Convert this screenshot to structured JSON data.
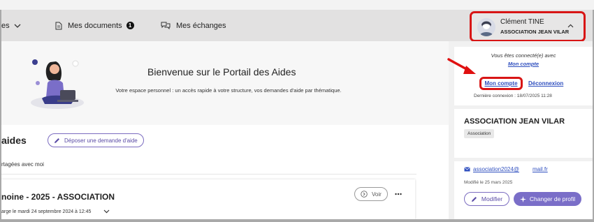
{
  "nav": {
    "aides_label": "es",
    "documents_label": "Mes documents",
    "documents_badge": "1",
    "echanges_label": "Mes échanges"
  },
  "user": {
    "name": "Clément TINE",
    "organization": "ASSOCIATION JEAN VILAR"
  },
  "welcome": {
    "title": "Bienvenue sur le Portail des Aides",
    "description": "Votre espace personnel : un accès rapide à votre structure, vos demandes d'aide par thématique."
  },
  "aides": {
    "title": "aides",
    "deposit_button": "Déposer une demande d'aide",
    "shared_label": "rtagées avec moi",
    "card": {
      "title": "noine - 2025 - ASSOCIATION",
      "subtitle": "arge le mardi 24 septembre 2024 à 12:45",
      "voir_button": "Voir",
      "more_icon": "ellipsis-icon"
    }
  },
  "account": {
    "connected_text": "Vous êtes connecté(e) avec",
    "account_link": "Mon compte",
    "mon_compte_button": "Mon compte",
    "deconnexion": "Déconnexion",
    "last_login": "Dernière connexion : 18/07/2025 11:28"
  },
  "organization": {
    "name": "ASSOCIATION JEAN VILAR",
    "tag": "Association",
    "email_part1": "association2024@",
    "email_part2": "mail.fr",
    "modified": "Modifié le 25 mars 2025",
    "modifier_button": "Modifier",
    "changer_button": "Changer de profil"
  },
  "colors": {
    "accent": "#7a6ec8",
    "highlight": "#d81515",
    "link": "#2f4fbf"
  }
}
